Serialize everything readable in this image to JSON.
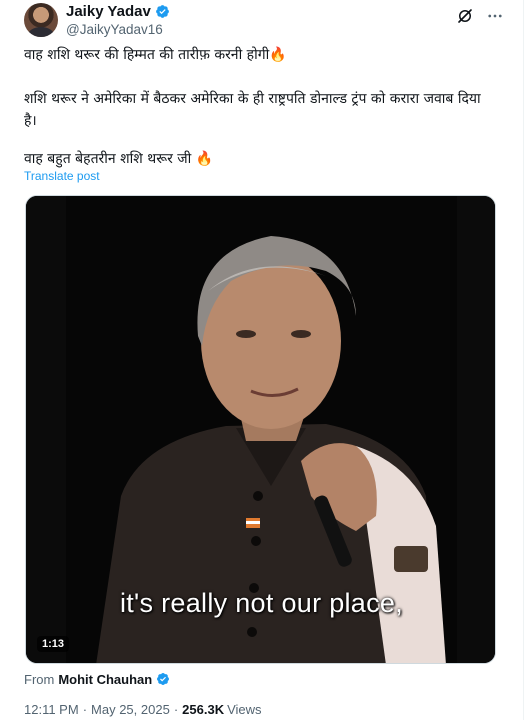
{
  "author": {
    "display_name": "Jaiky Yadav",
    "handle": "@JaikyYadav16"
  },
  "tweet": {
    "line1": "वाह शशि थरूर की हिम्मत की तारीफ़ करनी होगी",
    "line2": "शशि थरूर ने अमेरिका में बैठकर अमेरिका के ही राष्ट्रपति डोनाल्ड ट्रंप को करारा जवाब दिया है।",
    "line3": "वाह बहुत बेहतरीन शशि थरूर जी ",
    "emoji": "🔥"
  },
  "translate_label": "Translate post",
  "video": {
    "caption": "it's really not our place,",
    "duration": "1:13"
  },
  "source": {
    "label": "From",
    "name": "Mohit Chauhan"
  },
  "meta": {
    "time": "12:11 PM",
    "date": "May 25, 2025",
    "views_count": "256.3K",
    "views_label": "Views",
    "separator": "·"
  },
  "colors": {
    "accent": "#1d9bf0",
    "secondary_text": "#536471"
  },
  "icons": [
    "verified-badge-icon",
    "grok-icon",
    "more-icon",
    "fire-emoji"
  ]
}
